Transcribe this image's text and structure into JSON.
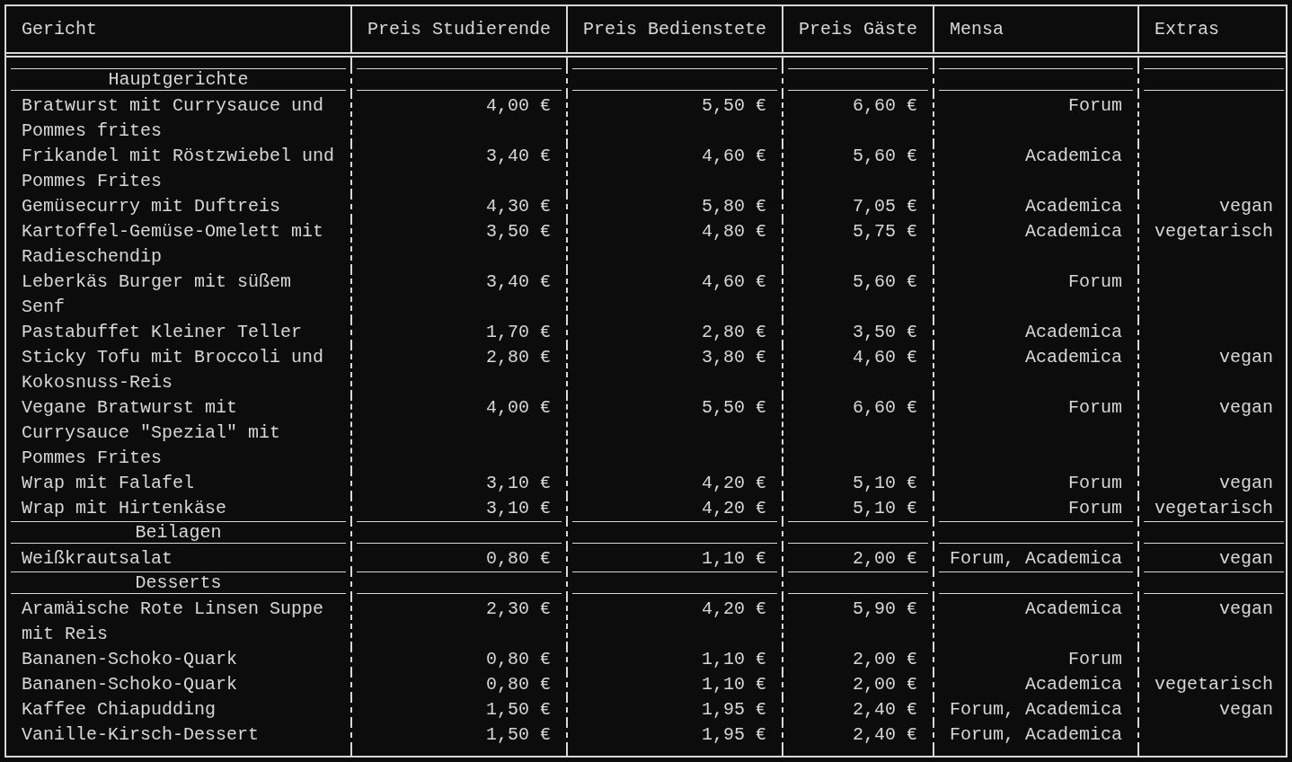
{
  "columns": [
    "Gericht",
    "Preis Studierende",
    "Preis Bedienstete",
    "Preis Gäste",
    "Mensa",
    "Extras"
  ],
  "sections": [
    {
      "title": "Hauptgerichte",
      "rows": [
        {
          "dish": "Bratwurst mit Currysauce und Pommes frites",
          "student": "4,00 €",
          "staff": "5,50 €",
          "guest": "6,60 €",
          "mensa": "Forum"
        },
        {
          "dish": "Frikandel mit Röstzwiebel und Pommes Frites",
          "student": "3,40 €",
          "staff": "4,60 €",
          "guest": "5,60 €",
          "mensa": "Academica"
        },
        {
          "dish": "Gemüsecurry mit Duftreis",
          "student": "4,30 €",
          "staff": "5,80 €",
          "guest": "7,05 €",
          "mensa": "Academica",
          "extras": "vegan"
        },
        {
          "dish": "Kartoffel-Gemüse-Omelett mit Radieschendip",
          "student": "3,50 €",
          "staff": "4,80 €",
          "guest": "5,75 €",
          "mensa": "Academica",
          "extras": "vegetarisch"
        },
        {
          "dish": "Leberkäs Burger mit süßem Senf",
          "student": "3,40 €",
          "staff": "4,60 €",
          "guest": "5,60 €",
          "mensa": "Forum"
        },
        {
          "dish": "Pastabuffet Kleiner Teller",
          "student": "1,70 €",
          "staff": "2,80 €",
          "guest": "3,50 €",
          "mensa": "Academica"
        },
        {
          "dish": "Sticky Tofu mit Broccoli und Kokosnuss-Reis",
          "student": "2,80 €",
          "staff": "3,80 €",
          "guest": "4,60 €",
          "mensa": "Academica",
          "extras": "vegan"
        },
        {
          "dish": "Vegane Bratwurst mit Currysauce \"Spezial\" mit Pommes Frites",
          "student": "4,00 €",
          "staff": "5,50 €",
          "guest": "6,60 €",
          "mensa": "Forum",
          "extras": "vegan"
        },
        {
          "dish": "Wrap mit Falafel",
          "student": "3,10 €",
          "staff": "4,20 €",
          "guest": "5,10 €",
          "mensa": "Forum",
          "extras": "vegan"
        },
        {
          "dish": "Wrap mit Hirtenkäse",
          "student": "3,10 €",
          "staff": "4,20 €",
          "guest": "5,10 €",
          "mensa": "Forum",
          "extras": "vegetarisch"
        }
      ]
    },
    {
      "title": "Beilagen",
      "rows": [
        {
          "dish": "Weißkrautsalat",
          "student": "0,80 €",
          "staff": "1,10 €",
          "guest": "2,00 €",
          "mensa": "Forum, Academica",
          "extras": "vegan"
        }
      ]
    },
    {
      "title": "Desserts",
      "rows": [
        {
          "dish": "Aramäische Rote Linsen Suppe mit Reis",
          "student": "2,30 €",
          "staff": "4,20 €",
          "guest": "5,90 €",
          "mensa": "Academica",
          "extras": "vegan"
        },
        {
          "dish": "Bananen-Schoko-Quark",
          "student": "0,80 €",
          "staff": "1,10 €",
          "guest": "2,00 €",
          "mensa": "Forum"
        },
        {
          "dish": "Bananen-Schoko-Quark",
          "student": "0,80 €",
          "staff": "1,10 €",
          "guest": "2,00 €",
          "mensa": "Academica",
          "extras": "vegetarisch"
        },
        {
          "dish": "Kaffee Chiapudding",
          "student": "1,50 €",
          "staff": "1,95 €",
          "guest": "2,40 €",
          "mensa": "Forum, Academica",
          "extras": "vegan"
        },
        {
          "dish": "Vanille-Kirsch-Dessert",
          "student": "1,50 €",
          "staff": "1,95 €",
          "guest": "2,40 €",
          "mensa": "Forum, Academica"
        }
      ]
    }
  ]
}
